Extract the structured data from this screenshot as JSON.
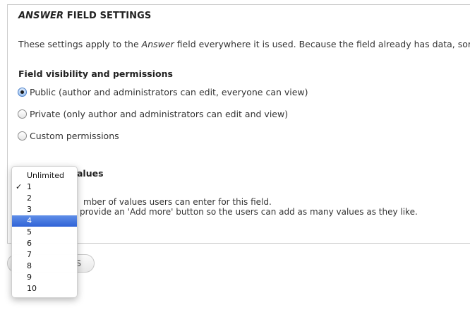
{
  "fieldset": {
    "legend_field": "ANSWER",
    "legend_rest": " FIELD SETTINGS",
    "intro_prefix": "These settings apply to the ",
    "intro_field": "Answer",
    "intro_suffix": " field everywhere it is used. Because the field already has data, som"
  },
  "visibility": {
    "title": "Field visibility and permissions",
    "options": [
      {
        "label": "Public (author and administrators can edit, everyone can view)",
        "checked": true
      },
      {
        "label": "Private (only author and administrators can edit and view)",
        "checked": false
      },
      {
        "label": "Custom permissions",
        "checked": false
      }
    ]
  },
  "values": {
    "title_partial": "alues",
    "desc_line1": "mber of values users can enter for this field.",
    "desc_line2": "provide an 'Add more' button so the users can add as many values as they like."
  },
  "save_button": {
    "label_partial": "S"
  },
  "dropdown": {
    "options": [
      "Unlimited",
      "1",
      "2",
      "3",
      "4",
      "5",
      "6",
      "7",
      "8",
      "9",
      "10"
    ],
    "checked_value": "1",
    "highlighted_value": "4",
    "check_mark": "✓"
  }
}
